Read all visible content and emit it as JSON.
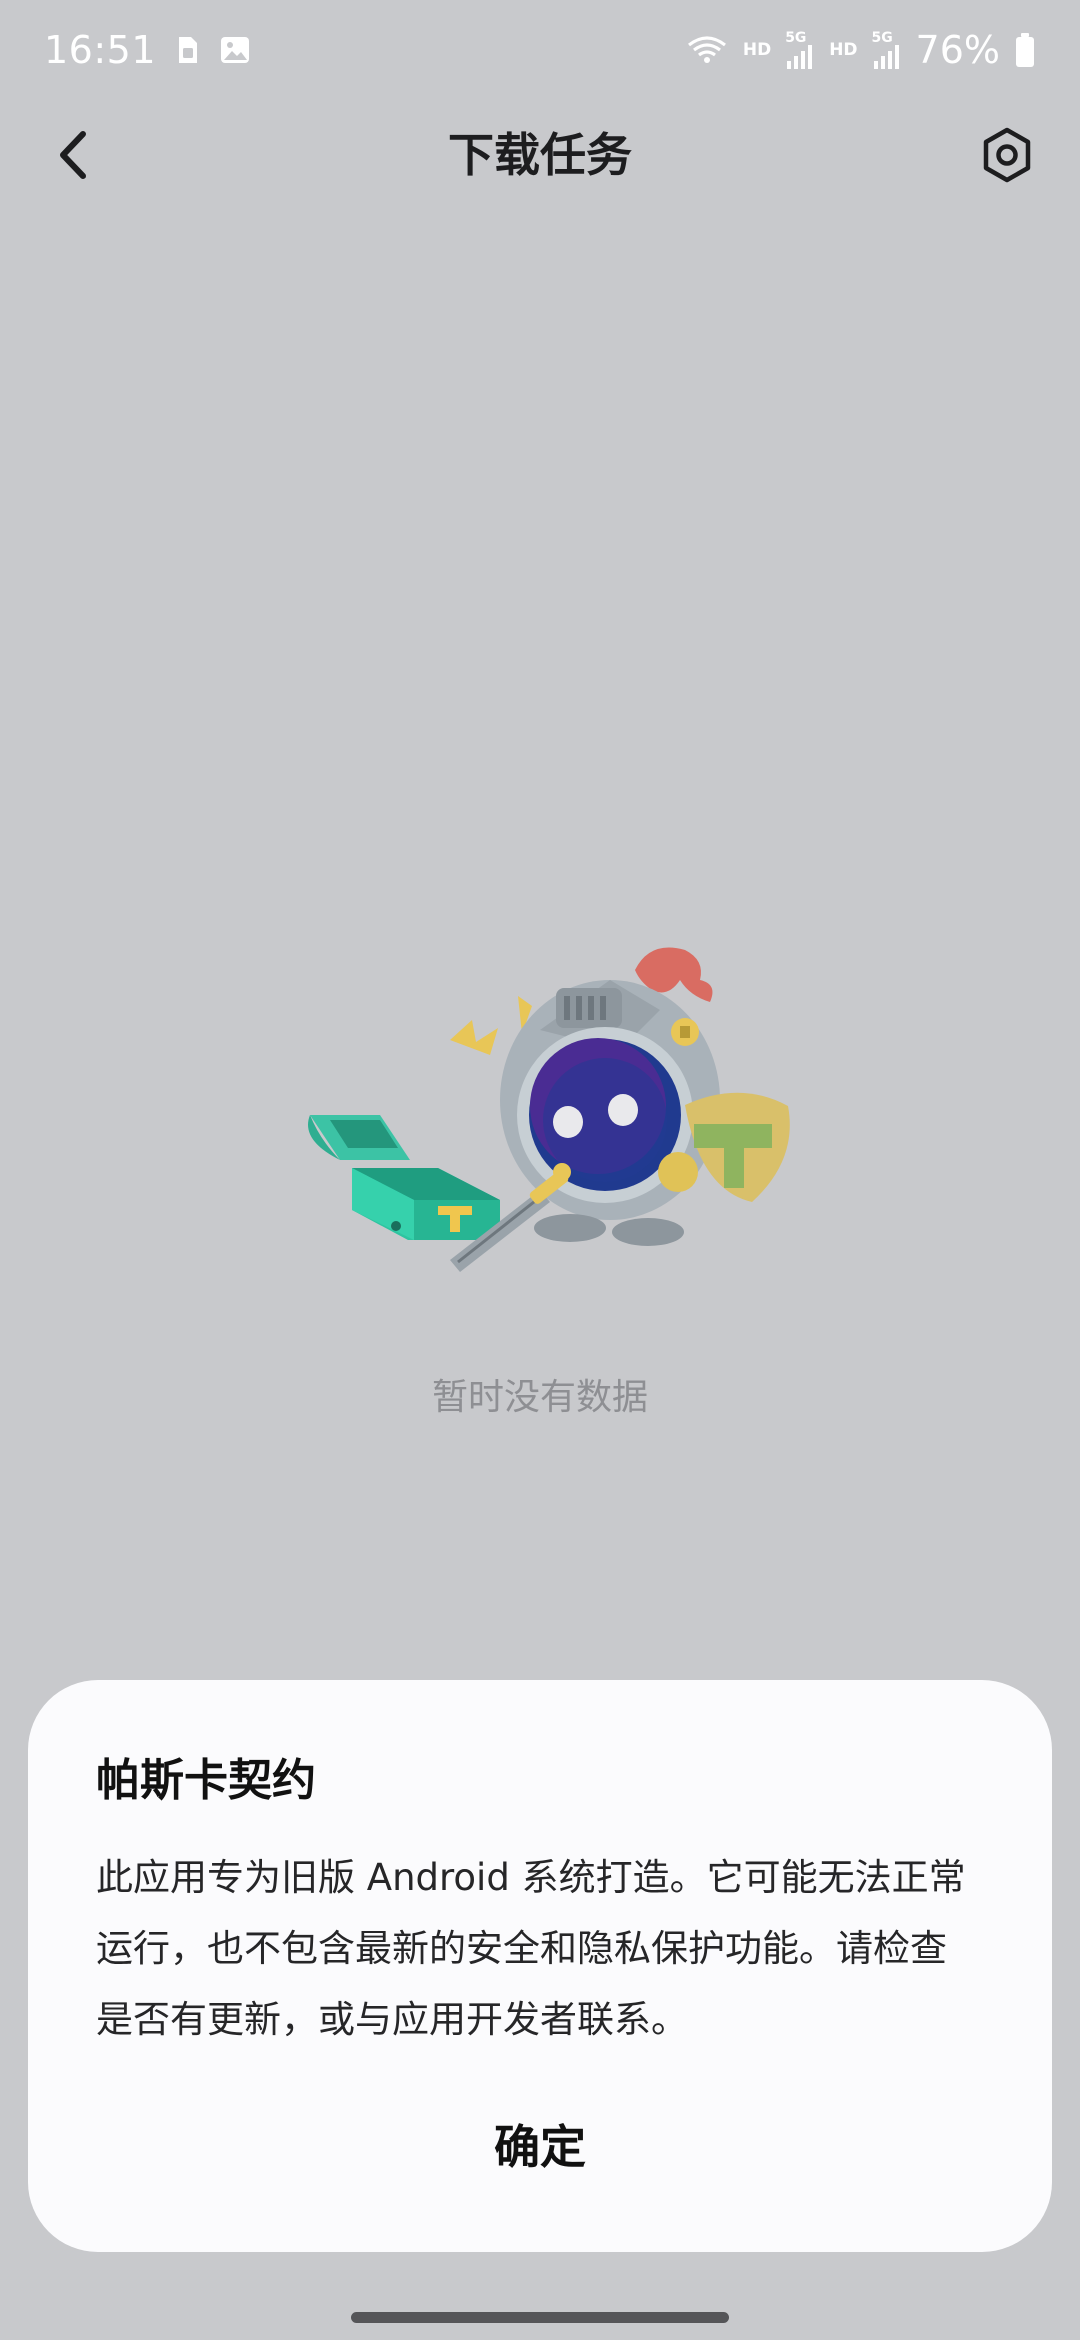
{
  "status_bar": {
    "time": "16:51",
    "battery_percent": "76%",
    "network_labels": [
      "HD",
      "5G",
      "HD",
      "5G"
    ],
    "icons": [
      "sim-card-icon",
      "image-icon",
      "wifi-icon",
      "signal-icon",
      "signal-icon",
      "battery-icon"
    ]
  },
  "app_bar": {
    "title": "下载任务",
    "back_icon": "chevron-left-icon",
    "settings_icon": "settings-hexagon-icon"
  },
  "empty_state": {
    "message": "暂时没有数据",
    "illustration": "knight-with-treasure-chest"
  },
  "dialog": {
    "title": "帕斯卡契约",
    "message_line1": "此应用专为旧版 Android 系统打造。它可能无法正常",
    "message_line2": "运行，也不包含最新的安全和隐私保护功能。请检查",
    "message_line3": "是否有更新，或与应用开发者联系。",
    "confirm_label": "确定"
  },
  "colors": {
    "background_dim": "#c8c9cc",
    "dialog_bg": "#fbfbfd",
    "empty_text": "#8e8f93"
  }
}
